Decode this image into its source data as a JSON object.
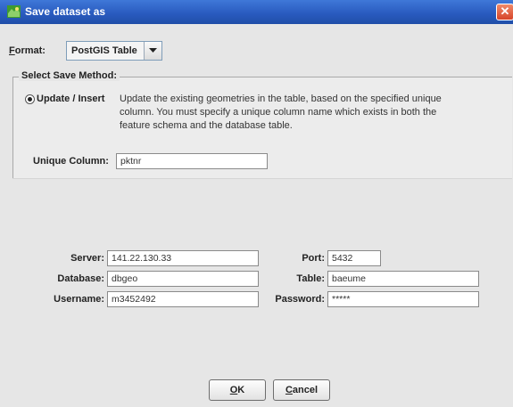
{
  "window": {
    "title": "Save dataset as",
    "close_glyph": "✕"
  },
  "format": {
    "label_first": "F",
    "label_rest": "ormat:",
    "selected": "PostGIS Table"
  },
  "save_method": {
    "group_title": "Select Save Method:",
    "option_label": "Update / Insert",
    "option_selected": true,
    "description_lines": [
      "Update the existing geometries in the table, based on the specified unique",
      "column. You must specify a unique column name which exists in both the",
      "feature schema and the database table."
    ],
    "unique_column_label": "Unique Column:",
    "unique_column_value": "pktnr"
  },
  "connection": {
    "server_label": "Server:",
    "server_value": "141.22.130.33",
    "port_label": "Port:",
    "port_value": "5432",
    "database_label": "Database:",
    "database_value": "dbgeo",
    "table_label": "Table:",
    "table_value": "baeume",
    "username_label": "Username:",
    "username_value": "m3452492",
    "password_label": "Password:",
    "password_value": "*****"
  },
  "buttons": {
    "ok_first": "O",
    "ok_rest": "K",
    "cancel_first": "C",
    "cancel_rest": "ancel"
  },
  "icons": {
    "app": "map-icon",
    "close": "close-icon",
    "dropdown": "chevron-down-icon"
  },
  "colors": {
    "titlebar": "#2a5bc0",
    "close": "#d6452a"
  }
}
